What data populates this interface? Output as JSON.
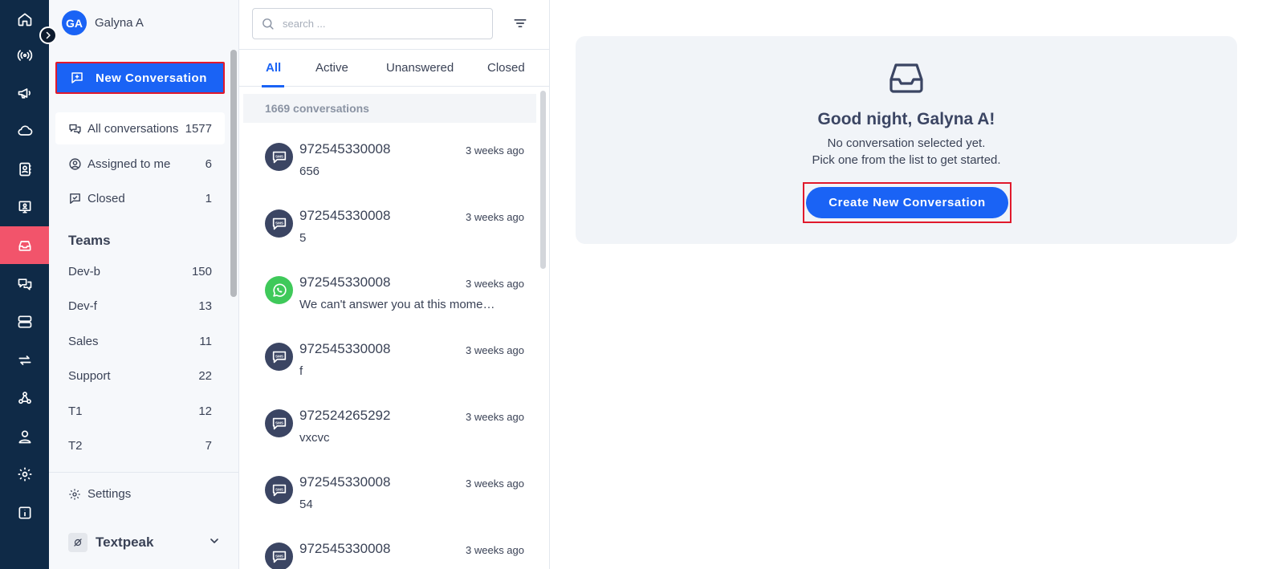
{
  "user": {
    "initials": "GA",
    "name": "Galyna A"
  },
  "sidebar": {
    "new_conversation_label": "New Conversation",
    "nav": [
      {
        "label": "All conversations",
        "count": "1577"
      },
      {
        "label": "Assigned to me",
        "count": "6"
      },
      {
        "label": "Closed",
        "count": "1"
      }
    ],
    "teams_heading": "Teams",
    "teams": [
      {
        "label": "Dev-b",
        "count": "150"
      },
      {
        "label": "Dev-f",
        "count": "13"
      },
      {
        "label": "Sales",
        "count": "11"
      },
      {
        "label": "Support",
        "count": "22"
      },
      {
        "label": "T1",
        "count": "12"
      },
      {
        "label": "T2",
        "count": "7"
      }
    ],
    "settings_label": "Settings",
    "workspace_name": "Textpeak"
  },
  "list": {
    "search_placeholder": "search ...",
    "tabs": [
      "All",
      "Active",
      "Unanswered",
      "Closed"
    ],
    "count_label": "1669 conversations",
    "conversations": [
      {
        "channel": "sms",
        "name": "972545330008",
        "time": "3 weeks ago",
        "message": "656"
      },
      {
        "channel": "sms",
        "name": "972545330008",
        "time": "3 weeks ago",
        "message": "5"
      },
      {
        "channel": "whatsapp",
        "name": "972545330008",
        "time": "3 weeks ago",
        "message": "We can't answer you at this moment. Please leave a message"
      },
      {
        "channel": "sms",
        "name": "972545330008",
        "time": "3 weeks ago",
        "message": "f"
      },
      {
        "channel": "sms",
        "name": "972524265292",
        "time": "3 weeks ago",
        "message": "vxcvc"
      },
      {
        "channel": "sms",
        "name": "972545330008",
        "time": "3 weeks ago",
        "message": "54"
      },
      {
        "channel": "sms",
        "name": "972545330008",
        "time": "3 weeks ago",
        "message": ""
      }
    ]
  },
  "main": {
    "greeting": "Good night, Galyna A!",
    "line1": "No conversation selected yet.",
    "line2": "Pick one from the list to get started.",
    "create_label": "Create New Conversation"
  },
  "colors": {
    "rail": "#0f2a47",
    "accent": "#1a63f5",
    "active_rail": "#f2546b",
    "highlight_border": "#e0192c",
    "whatsapp": "#3fc95a"
  }
}
